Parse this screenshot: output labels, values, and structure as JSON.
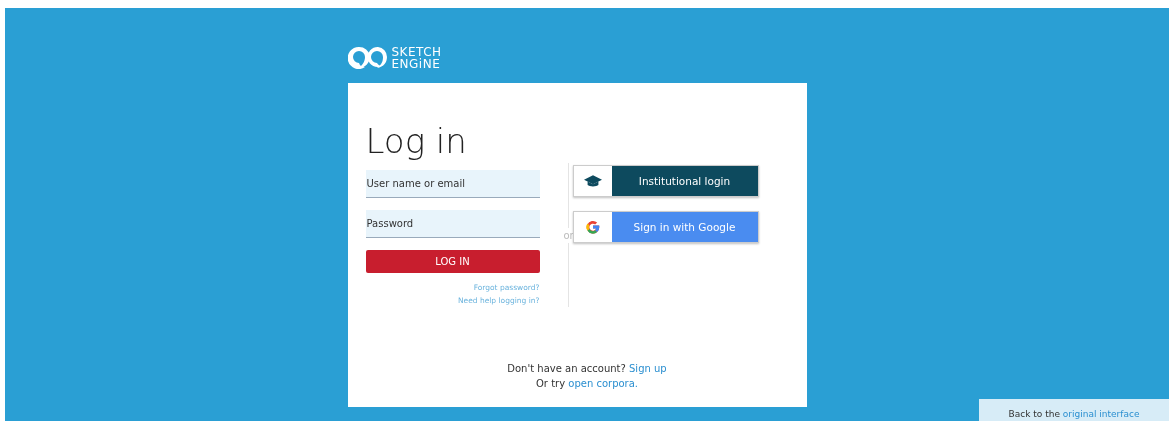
{
  "logo": {
    "line_1": "SKETCH",
    "line_2": "ENGiNE"
  },
  "title": "Log in",
  "fields": [
    {
      "placeholder": "User name or email"
    },
    {
      "placeholder": "Password"
    }
  ],
  "login_button": "LOG IN",
  "links": [
    "Forgot password?",
    "Need help logging in?"
  ],
  "separator": "or",
  "external_buttons": [
    {
      "kind": "institutional",
      "label": "Institutional login"
    },
    {
      "kind": "google",
      "label": "Sign in with Google"
    }
  ],
  "signup": {
    "text": "Don't have an account?",
    "link": "Sign up"
  },
  "open_corpora": {
    "text": "Or try",
    "link": "open corpora."
  },
  "back_bar": {
    "text": "Back to the",
    "link": "original interface"
  }
}
